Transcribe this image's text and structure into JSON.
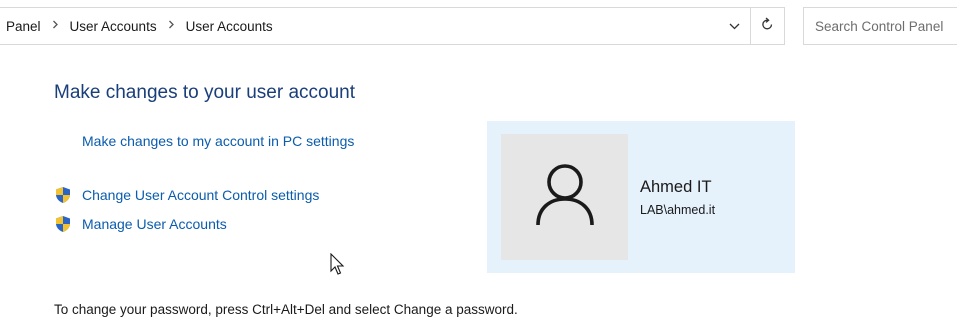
{
  "address_bar": {
    "breadcrumbs": [
      {
        "label": "Panel"
      },
      {
        "label": "User Accounts"
      },
      {
        "label": "User Accounts"
      }
    ],
    "separator_icon": "chevron-right-icon",
    "dropdown_icon": "chevron-down-icon",
    "refresh_icon": "refresh-icon"
  },
  "search": {
    "placeholder": "Search Control Panel"
  },
  "main": {
    "title": "Make changes to your user account",
    "links": {
      "pc_settings": "Make changes to my account in PC settings",
      "uac_settings": "Change User Account Control settings",
      "manage_accounts": "Manage User Accounts"
    },
    "task_icon": "uac-shield-icon",
    "password_note": "To change your password, press Ctrl+Alt+Del and select Change a password."
  },
  "user": {
    "name": "Ahmed IT",
    "account": "LAB\\ahmed.it",
    "avatar_icon": "user-silhouette-icon"
  },
  "colors": {
    "link": "#0b5cad",
    "title": "#1a3e7a",
    "tile_background": "#e5f1fb",
    "avatar_background": "#e6e6e6"
  }
}
